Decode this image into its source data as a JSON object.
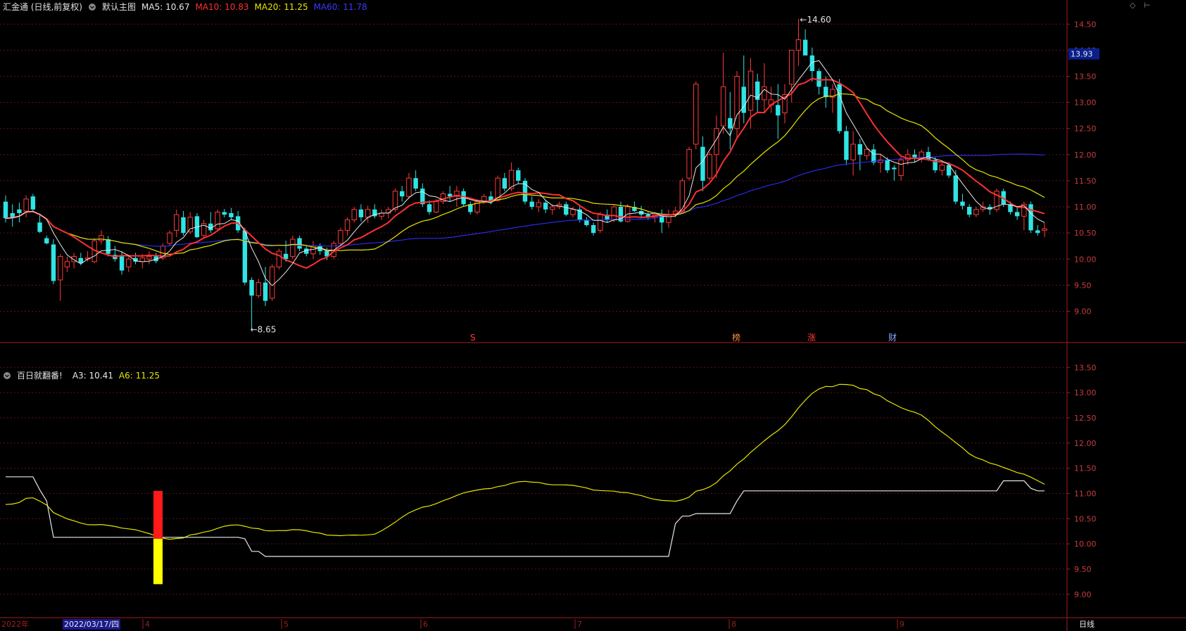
{
  "header": {
    "title": "汇金通 (日线,前复权)",
    "template": "默认主图",
    "ma5": {
      "label": "MA5:",
      "value": "10.67",
      "color": "#e8e8e8"
    },
    "ma10": {
      "label": "MA10:",
      "value": "10.83",
      "color": "#ff3030"
    },
    "ma20": {
      "label": "MA20:",
      "value": "11.25",
      "color": "#e5e500"
    },
    "ma60": {
      "label": "MA60:",
      "value": "11.78",
      "color": "#2a2ae8"
    }
  },
  "sub_header": {
    "title": "百日就翻番!",
    "a3": {
      "label": "A3:",
      "value": "10.41",
      "color": "#e8e8e8"
    },
    "a6": {
      "label": "A6:",
      "value": "11.25",
      "color": "#e5e500"
    }
  },
  "footer": {
    "year": "2022年",
    "cursor_date": "2022/03/17/四",
    "period": "日线"
  },
  "current_price": "13.93",
  "colors": {
    "up": "#ff3b3b",
    "down": "#2fe4e4",
    "axis": "#a01e1e",
    "grid": "#5a1414",
    "bg": "#000000"
  },
  "chart_data": [
    {
      "type": "candlestick",
      "y_ticks": [
        "14.50",
        "14.00",
        "13.50",
        "13.00",
        "12.50",
        "12.00",
        "11.50",
        "11.00",
        "10.50",
        "10.00",
        "9.50",
        "9.00"
      ],
      "ylim": [
        8.4,
        14.8
      ],
      "x_month_labels": [
        "4",
        "5",
        "6",
        "7",
        "8",
        "9"
      ],
      "annotations": [
        {
          "text": "14.60",
          "kind": "high"
        },
        {
          "text": "8.65",
          "kind": "low"
        },
        {
          "text": "S",
          "color": "#ff3b3b"
        },
        {
          "text": "榜",
          "color": "#ff8a3b"
        },
        {
          "text": "涨",
          "color": "#ff3b3b"
        },
        {
          "text": "财",
          "color": "#8aa8ff"
        }
      ],
      "candles": [
        [
          11.1,
          11.22,
          10.7,
          10.78
        ],
        [
          10.88,
          11.05,
          10.62,
          10.8
        ],
        [
          10.95,
          11.08,
          10.7,
          10.88
        ],
        [
          10.92,
          11.22,
          10.8,
          11.15
        ],
        [
          11.2,
          11.25,
          10.9,
          10.95
        ],
        [
          10.7,
          10.85,
          10.5,
          10.52
        ],
        [
          10.4,
          10.45,
          10.28,
          10.3
        ],
        [
          10.28,
          10.38,
          9.52,
          9.58
        ],
        [
          9.6,
          10.1,
          9.2,
          10.05
        ],
        [
          9.85,
          10.05,
          9.75,
          9.95
        ],
        [
          9.95,
          10.12,
          9.82,
          10.05
        ],
        [
          10.02,
          10.12,
          9.88,
          9.92
        ],
        [
          10.0,
          10.15,
          9.95,
          10.02
        ],
        [
          9.95,
          10.4,
          9.92,
          10.35
        ],
        [
          10.35,
          10.55,
          10.28,
          10.45
        ],
        [
          10.38,
          10.44,
          10.05,
          10.1
        ],
        [
          10.08,
          10.25,
          9.95,
          10.0
        ],
        [
          10.05,
          10.15,
          9.7,
          9.78
        ],
        [
          9.85,
          10.05,
          9.75,
          10.0
        ],
        [
          10.02,
          10.12,
          9.9,
          9.95
        ],
        [
          9.95,
          10.1,
          9.82,
          10.02
        ],
        [
          10.0,
          10.15,
          9.9,
          10.05
        ],
        [
          10.05,
          10.12,
          9.92,
          9.96
        ],
        [
          10.02,
          10.3,
          9.98,
          10.25
        ],
        [
          10.3,
          10.55,
          10.25,
          10.5
        ],
        [
          10.55,
          10.95,
          10.42,
          10.85
        ],
        [
          10.8,
          10.92,
          10.45,
          10.5
        ],
        [
          10.52,
          10.9,
          10.48,
          10.8
        ],
        [
          10.82,
          10.88,
          10.4,
          10.42
        ],
        [
          10.45,
          10.75,
          10.4,
          10.68
        ],
        [
          10.68,
          10.9,
          10.5,
          10.55
        ],
        [
          10.58,
          10.95,
          10.55,
          10.9
        ],
        [
          10.9,
          10.96,
          10.8,
          10.85
        ],
        [
          10.88,
          10.98,
          10.75,
          10.8
        ],
        [
          10.82,
          10.92,
          10.5,
          10.55
        ],
        [
          10.55,
          10.6,
          9.5,
          9.55
        ],
        [
          9.6,
          9.65,
          8.65,
          9.3
        ],
        [
          9.3,
          9.62,
          9.25,
          9.55
        ],
        [
          9.55,
          9.85,
          9.1,
          9.2
        ],
        [
          9.25,
          9.9,
          9.2,
          9.85
        ],
        [
          9.85,
          10.2,
          9.8,
          10.15
        ],
        [
          10.1,
          10.35,
          9.95,
          10.0
        ],
        [
          10.05,
          10.45,
          10.0,
          10.38
        ],
        [
          10.4,
          10.45,
          10.15,
          10.2
        ],
        [
          10.2,
          10.25,
          10.05,
          10.1
        ],
        [
          10.1,
          10.35,
          10.0,
          10.25
        ],
        [
          10.25,
          10.3,
          10.08,
          10.15
        ],
        [
          10.15,
          10.22,
          9.98,
          10.05
        ],
        [
          10.05,
          10.35,
          10.0,
          10.3
        ],
        [
          10.3,
          10.6,
          10.25,
          10.55
        ],
        [
          10.55,
          10.8,
          10.45,
          10.75
        ],
        [
          10.75,
          11.0,
          10.7,
          10.95
        ],
        [
          10.95,
          11.05,
          10.72,
          10.8
        ],
        [
          10.8,
          11.02,
          10.7,
          10.95
        ],
        [
          10.95,
          11.05,
          10.78,
          10.82
        ],
        [
          10.82,
          10.95,
          10.75,
          10.88
        ],
        [
          10.88,
          11.0,
          10.78,
          10.95
        ],
        [
          10.95,
          11.35,
          10.9,
          11.3
        ],
        [
          11.3,
          11.4,
          11.1,
          11.2
        ],
        [
          11.2,
          11.65,
          11.15,
          11.55
        ],
        [
          11.55,
          11.7,
          11.3,
          11.35
        ],
        [
          11.35,
          11.45,
          11.0,
          11.05
        ],
        [
          11.05,
          11.12,
          10.85,
          10.9
        ],
        [
          10.9,
          11.15,
          10.88,
          11.1
        ],
        [
          11.1,
          11.3,
          11.05,
          11.25
        ],
        [
          11.25,
          11.4,
          11.1,
          11.2
        ],
        [
          11.2,
          11.4,
          11.0,
          11.3
        ],
        [
          11.3,
          11.35,
          11.0,
          11.05
        ],
        [
          11.05,
          11.1,
          10.85,
          10.9
        ],
        [
          10.9,
          11.15,
          10.85,
          11.1
        ],
        [
          11.1,
          11.25,
          11.05,
          11.2
        ],
        [
          11.2,
          11.3,
          11.05,
          11.12
        ],
        [
          11.12,
          11.6,
          11.1,
          11.55
        ],
        [
          11.55,
          11.65,
          11.3,
          11.35
        ],
        [
          11.35,
          11.85,
          11.3,
          11.7
        ],
        [
          11.7,
          11.75,
          11.45,
          11.5
        ],
        [
          11.5,
          11.55,
          11.05,
          11.1
        ],
        [
          11.1,
          11.2,
          10.95,
          11.0
        ],
        [
          11.0,
          11.15,
          10.9,
          11.08
        ],
        [
          11.08,
          11.12,
          10.88,
          10.95
        ],
        [
          10.95,
          11.05,
          10.85,
          11.0
        ],
        [
          11.0,
          11.1,
          10.95,
          11.05
        ],
        [
          11.05,
          11.1,
          10.82,
          10.85
        ],
        [
          10.85,
          11.0,
          10.8,
          10.95
        ],
        [
          10.95,
          11.02,
          10.7,
          10.75
        ],
        [
          10.75,
          10.8,
          10.62,
          10.65
        ],
        [
          10.65,
          10.7,
          10.45,
          10.5
        ],
        [
          10.55,
          10.9,
          10.5,
          10.85
        ],
        [
          10.85,
          10.95,
          10.7,
          10.75
        ],
        [
          10.75,
          11.05,
          10.7,
          11.0
        ],
        [
          11.0,
          11.1,
          10.7,
          10.72
        ],
        [
          10.72,
          11.05,
          10.7,
          11.0
        ],
        [
          11.0,
          11.1,
          10.9,
          10.92
        ],
        [
          10.92,
          11.02,
          10.78,
          10.85
        ],
        [
          10.85,
          10.9,
          10.75,
          10.8
        ],
        [
          10.8,
          10.9,
          10.7,
          10.85
        ],
        [
          10.85,
          10.95,
          10.5,
          10.7
        ],
        [
          10.7,
          10.95,
          10.6,
          10.85
        ],
        [
          10.85,
          11.0,
          10.8,
          10.92
        ],
        [
          10.92,
          11.55,
          10.9,
          11.5
        ],
        [
          11.55,
          12.15,
          11.5,
          12.1
        ],
        [
          12.2,
          13.4,
          12.1,
          13.35
        ],
        [
          12.15,
          12.35,
          11.3,
          11.5
        ],
        [
          11.55,
          12.05,
          11.5,
          12.0
        ],
        [
          12.0,
          12.75,
          11.55,
          12.5
        ],
        [
          12.55,
          13.95,
          12.4,
          13.3
        ],
        [
          12.7,
          13.2,
          12.1,
          12.5
        ],
        [
          12.5,
          13.6,
          12.3,
          13.5
        ],
        [
          13.3,
          13.9,
          12.6,
          12.8
        ],
        [
          12.85,
          13.85,
          12.5,
          13.6
        ],
        [
          13.4,
          13.55,
          12.8,
          13.05
        ],
        [
          13.05,
          13.75,
          12.8,
          13.3
        ],
        [
          12.95,
          13.3,
          12.8,
          13.05
        ],
        [
          12.95,
          13.35,
          12.3,
          12.75
        ],
        [
          12.8,
          13.35,
          12.6,
          13.15
        ],
        [
          13.35,
          14.0,
          13.0,
          14.0
        ],
        [
          14.0,
          14.6,
          13.7,
          14.2
        ],
        [
          14.2,
          14.4,
          13.9,
          13.9
        ],
        [
          13.9,
          14.05,
          13.4,
          13.6
        ],
        [
          13.6,
          13.65,
          13.15,
          13.3
        ],
        [
          13.3,
          13.5,
          12.9,
          13.1
        ],
        [
          13.1,
          13.35,
          12.8,
          13.25
        ],
        [
          13.35,
          13.45,
          12.4,
          12.45
        ],
        [
          12.45,
          12.55,
          11.8,
          11.9
        ],
        [
          11.9,
          12.45,
          11.6,
          12.2
        ],
        [
          12.2,
          12.3,
          11.7,
          12.0
        ],
        [
          11.98,
          12.15,
          11.9,
          12.1
        ],
        [
          12.1,
          12.2,
          11.8,
          11.85
        ],
        [
          11.85,
          12.0,
          11.65,
          11.9
        ],
        [
          11.9,
          11.95,
          11.65,
          11.7
        ],
        [
          11.75,
          11.8,
          11.5,
          11.72
        ],
        [
          11.6,
          11.95,
          11.5,
          11.9
        ],
        [
          11.9,
          12.1,
          11.8,
          12.0
        ],
        [
          12.0,
          12.1,
          11.85,
          11.95
        ],
        [
          11.95,
          12.1,
          11.85,
          12.05
        ],
        [
          12.05,
          12.15,
          11.88,
          11.9
        ],
        [
          11.9,
          11.95,
          11.65,
          11.7
        ],
        [
          11.7,
          11.85,
          11.6,
          11.8
        ],
        [
          11.8,
          11.85,
          11.55,
          11.6
        ],
        [
          11.6,
          11.7,
          11.05,
          11.1
        ],
        [
          11.1,
          11.25,
          10.95,
          11.02
        ],
        [
          11.0,
          11.05,
          10.8,
          10.85
        ],
        [
          10.85,
          11.0,
          10.8,
          10.95
        ],
        [
          10.95,
          11.1,
          10.9,
          11.0
        ],
        [
          11.0,
          11.05,
          10.85,
          10.95
        ],
        [
          10.95,
          11.35,
          10.9,
          11.3
        ],
        [
          11.3,
          11.35,
          11.0,
          11.05
        ],
        [
          11.05,
          11.1,
          10.85,
          10.9
        ],
        [
          10.9,
          11.0,
          10.75,
          10.82
        ],
        [
          10.82,
          11.1,
          10.55,
          11.05
        ],
        [
          11.05,
          11.1,
          10.5,
          10.55
        ],
        [
          10.55,
          10.65,
          10.45,
          10.5
        ],
        [
          10.55,
          10.7,
          10.42,
          10.58
        ]
      ],
      "ma_values": {
        "MA5": "10.67",
        "MA10": "10.83",
        "MA20": "11.25",
        "MA60": "11.78"
      }
    },
    {
      "type": "line",
      "title": "百日就翻番!",
      "y_ticks": [
        "13.50",
        "13.00",
        "12.50",
        "12.00",
        "11.50",
        "11.00",
        "10.50",
        "10.00",
        "9.50",
        "9.00"
      ],
      "ylim": [
        8.55,
        13.95
      ],
      "series": [
        {
          "name": "A3",
          "color": "#e8e8e8",
          "final": "10.41"
        },
        {
          "name": "A6",
          "color": "#e5e500",
          "final": "11.25"
        }
      ],
      "signal_bar": {
        "red": [
          10.1,
          11.05
        ],
        "yellow": [
          9.2,
          10.1
        ]
      }
    }
  ]
}
